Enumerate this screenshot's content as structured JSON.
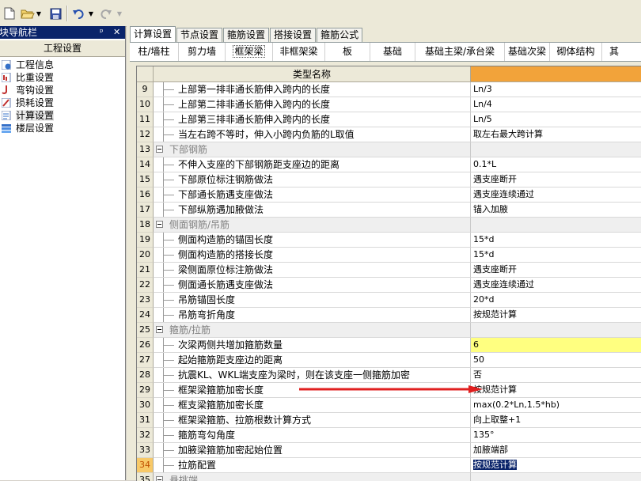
{
  "toolbar": {
    "icons": [
      "new-file-icon",
      "open-folder-icon",
      "dropdown-icon",
      "save-icon",
      "undo-icon",
      "dropdown-icon",
      "redo-icon",
      "dropdown-icon"
    ]
  },
  "nav": {
    "title": "模块导航栏",
    "pin": "ᵖ",
    "close": "✕",
    "header": "工程设置",
    "items": [
      {
        "label": "工程信息"
      },
      {
        "label": "比重设置"
      },
      {
        "label": "弯钩设置"
      },
      {
        "label": "损耗设置"
      },
      {
        "label": "计算设置"
      },
      {
        "label": "楼层设置"
      }
    ]
  },
  "tabs_top": [
    "计算设置",
    "节点设置",
    "箍筋设置",
    "搭接设置",
    "箍筋公式"
  ],
  "tabs_sub": [
    "柱/墙柱",
    "剪力墙",
    "框架梁",
    "非框架梁",
    "板",
    "基础",
    "基础主梁/承台梁",
    "基础次梁",
    "砌体结构",
    "其"
  ],
  "grid": {
    "header_name": "类型名称",
    "rows": [
      {
        "n": "9",
        "name": "上部第一排非通长筋伸入跨内的长度",
        "val": "Ln/3"
      },
      {
        "n": "10",
        "name": "上部第二排非通长筋伸入跨内的长度",
        "val": "Ln/4"
      },
      {
        "n": "11",
        "name": "上部第三排非通长筋伸入跨内的长度",
        "val": "Ln/5"
      },
      {
        "n": "12",
        "name": "当左右跨不等时，伸入小跨内负筋的L取值",
        "val": "取左右最大跨计算"
      },
      {
        "n": "13",
        "name": "下部钢筋",
        "val": "",
        "group": true
      },
      {
        "n": "14",
        "name": "不伸入支座的下部钢筋距支座边的距离",
        "val": "0.1*L"
      },
      {
        "n": "15",
        "name": "下部原位标注钢筋做法",
        "val": "遇支座断开"
      },
      {
        "n": "16",
        "name": "下部通长筋遇支座做法",
        "val": "遇支座连续通过"
      },
      {
        "n": "17",
        "name": "下部纵筋遇加腋做法",
        "val": "锚入加腋"
      },
      {
        "n": "18",
        "name": "侧面钢筋/吊筋",
        "val": "",
        "group": true
      },
      {
        "n": "19",
        "name": "侧面构造筋的锚固长度",
        "val": "15*d"
      },
      {
        "n": "20",
        "name": "侧面构造筋的搭接长度",
        "val": "15*d"
      },
      {
        "n": "21",
        "name": "梁侧面原位标注筋做法",
        "val": "遇支座断开"
      },
      {
        "n": "22",
        "name": "侧面通长筋遇支座做法",
        "val": "遇支座连续通过"
      },
      {
        "n": "23",
        "name": "吊筋锚固长度",
        "val": "20*d"
      },
      {
        "n": "24",
        "name": "吊筋弯折角度",
        "val": "按规范计算"
      },
      {
        "n": "25",
        "name": "箍筋/拉筋",
        "val": "",
        "group": true
      },
      {
        "n": "26",
        "name": "次梁两侧共增加箍筋数量",
        "val": "6",
        "hl": true
      },
      {
        "n": "27",
        "name": "起始箍筋距支座边的距离",
        "val": "50"
      },
      {
        "n": "28",
        "name": "抗震KL、WKL端支座为梁时，则在该支座一侧箍筋加密",
        "val": "否"
      },
      {
        "n": "29",
        "name": "框架梁箍筋加密长度",
        "val": "按规范计算"
      },
      {
        "n": "30",
        "name": "框支梁箍筋加密长度",
        "val": "max(0.2*Ln,1.5*hb)"
      },
      {
        "n": "31",
        "name": "框架梁箍筋、拉筋根数计算方式",
        "val": "向上取整+1"
      },
      {
        "n": "32",
        "name": "箍筋弯勾角度",
        "val": "135°"
      },
      {
        "n": "33",
        "name": "加腋梁箍筋加密起始位置",
        "val": "加腋端部"
      },
      {
        "n": "34",
        "name": "拉筋配置",
        "val": "按规范计算",
        "sel": true
      },
      {
        "n": "35",
        "name": "悬挑端",
        "val": "",
        "group": true
      }
    ]
  },
  "colors": {
    "accent": "#f2a33a",
    "arrow": "#e02020",
    "highlight": "#ffff80",
    "selection": "#0a246a"
  }
}
